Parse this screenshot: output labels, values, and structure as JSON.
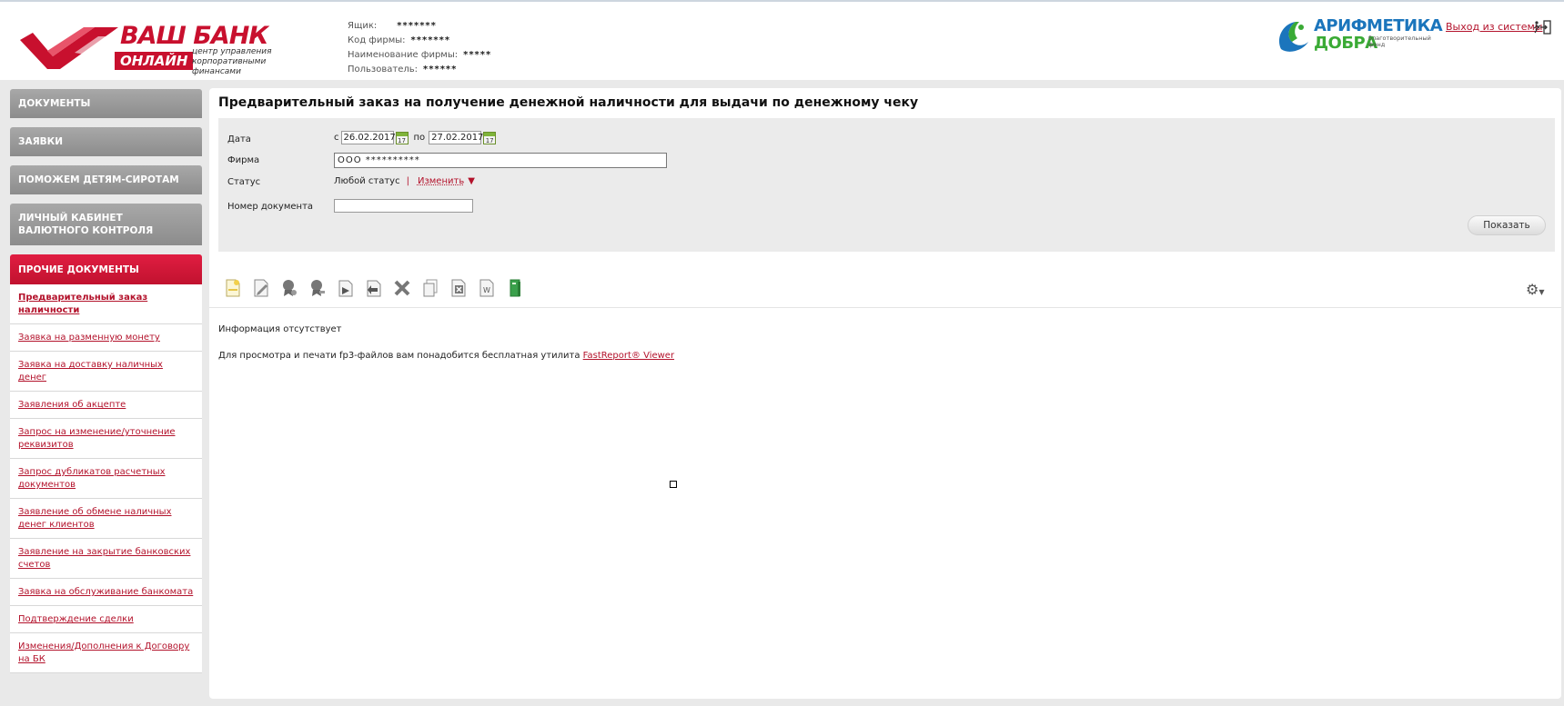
{
  "header": {
    "bank_name": "ВАШ БАНК",
    "bank_online": "ОНЛАЙН",
    "bank_subtitle": "центр управления корпоративными финансами",
    "info": [
      {
        "label": "Ящик:",
        "value": "*******"
      },
      {
        "label": "Код фирмы:",
        "value": "*******"
      },
      {
        "label": "Наименование фирмы:",
        "value": "*****"
      },
      {
        "label": "Пользователь:",
        "value": "******"
      }
    ],
    "partner": {
      "line1": "АРИФМЕТИКА",
      "line2": "ДОБРА",
      "line3": "благотворительный фонд"
    },
    "logout_label": "Выход из системы"
  },
  "sidebar": {
    "menu": [
      {
        "label": "ДОКУМЕНТЫ"
      },
      {
        "label": "ЗАЯВКИ"
      },
      {
        "label": "ПОМОЖЕМ ДЕТЯМ-СИРОТАМ"
      },
      {
        "label": "ЛИЧНЫЙ КАБИНЕТ ВАЛЮТНОГО КОНТРОЛЯ"
      },
      {
        "label": "ПРОЧИЕ ДОКУМЕНТЫ"
      }
    ],
    "submenu": [
      {
        "label": "Предварительный заказ наличности"
      },
      {
        "label": "Заявка на разменную монету"
      },
      {
        "label": "Заявка на доставку наличных денег"
      },
      {
        "label": "Заявления об акцепте"
      },
      {
        "label": "Запрос на изменение/уточнение реквизитов"
      },
      {
        "label": "Запрос дубликатов расчетных документов"
      },
      {
        "label": "Заявление об обмене наличных денег клиентов"
      },
      {
        "label": "Заявление на закрытие банковских счетов"
      },
      {
        "label": "Заявка на обслуживание банкомата"
      },
      {
        "label": "Подтверждение сделки"
      },
      {
        "label": "Изменения/Дополнения к Договору на БК"
      }
    ]
  },
  "main": {
    "title": "Предварительный заказ на получение денежной наличности для выдачи по денежному чеку",
    "filter": {
      "date_label": "Дата",
      "from_label": "с",
      "from_value": "26.02.2017",
      "to_label": "по",
      "to_value": "27.02.2017",
      "cal_day": "17",
      "firm_label": "Фирма",
      "firm_value": "ООО  **********",
      "status_label": "Статус",
      "status_value": "Любой статус",
      "status_sep": "|",
      "status_change": "Изменить",
      "doc_number_label": "Номер документа",
      "doc_number_value": "",
      "show_button": "Показать"
    },
    "no_info": "Информация отсутствует",
    "note_text": "Для просмотра и печати fp3-файлов вам понадобится бесплатная утилита ",
    "note_link": "FastReport® Viewer"
  }
}
